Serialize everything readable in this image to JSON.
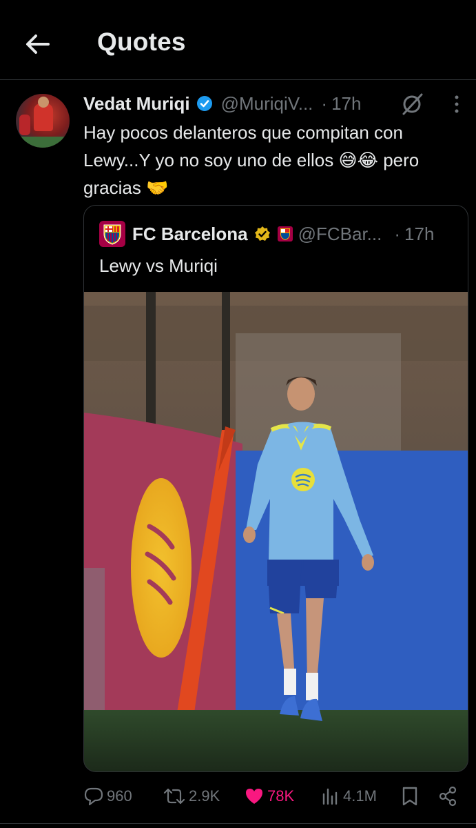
{
  "header": {
    "title": "Quotes",
    "back_icon": "arrow-left-icon"
  },
  "tweet": {
    "author_name": "Vedat Muriqi",
    "handle": "@MuriqiV...",
    "separator": "·",
    "time": "17h",
    "text": "Hay pocos delanteros que compitan con Lewy...Y yo no soy uno de ellos 😅😂 pero gracias 🤝",
    "icons": [
      "verified-badge-icon",
      "grok-icon",
      "more-icon"
    ]
  },
  "quoted": {
    "author_name": "FC Barcelona",
    "handle": "@FCBar...",
    "separator": "·",
    "time": "17h",
    "text": "Lewy vs Muriqi"
  },
  "actions": {
    "replies": "960",
    "reposts": "2.9K",
    "likes": "78K",
    "views": "4.1M",
    "liked_color": "#f91880"
  },
  "colors": {
    "background": "#000000",
    "text": "#e7e9ea",
    "muted": "#71767b",
    "verified": "#1d9bf0",
    "gold": "#e2b719"
  }
}
